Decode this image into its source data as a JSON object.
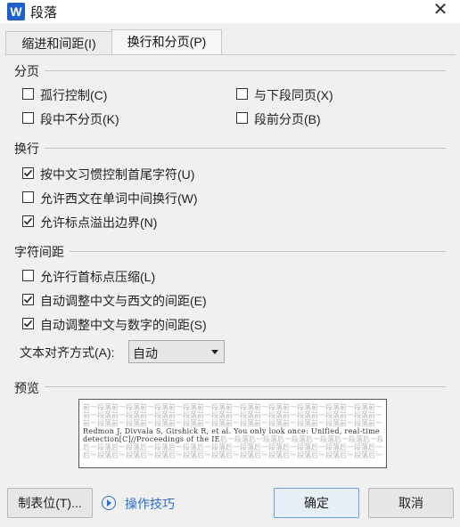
{
  "window": {
    "title": "段落",
    "app_icon_letter": "W",
    "close_glyph": "✕"
  },
  "tabs": [
    {
      "label": "缩进和间距(I)",
      "active": false
    },
    {
      "label": "换行和分页(P)",
      "active": true
    }
  ],
  "pagination": {
    "title": "分页",
    "options": [
      {
        "label": "孤行控制(C)",
        "checked": false
      },
      {
        "label": "与下段同页(X)",
        "checked": false
      },
      {
        "label": "段中不分页(K)",
        "checked": false
      },
      {
        "label": "段前分页(B)",
        "checked": false
      }
    ]
  },
  "line_break": {
    "title": "换行",
    "options": [
      {
        "label": "按中文习惯控制首尾字符(U)",
        "checked": true
      },
      {
        "label": "允许西文在单词中间换行(W)",
        "checked": false
      },
      {
        "label": "允许标点溢出边界(N)",
        "checked": true
      }
    ]
  },
  "char_spacing": {
    "title": "字符间距",
    "options": [
      {
        "label": "允许行首标点压缩(L)",
        "checked": false
      },
      {
        "label": "自动调整中文与西文的间距(E)",
        "checked": true
      },
      {
        "label": "自动调整中文与数字的间距(S)",
        "checked": true
      }
    ],
    "align_label": "文本对齐方式(A):",
    "align_value": "自动"
  },
  "preview": {
    "title": "预览",
    "lines": [
      "前一段落前一段落前一段落前一段落前一段落前一段落前一段落前一段落前一段落前一段落前一段落前一段落前一段落",
      "前一段落前一段落前一段落前一段落前一段落前一段落前一段落前一段落前一段落前一段落前一段落前一段落前一段落",
      "前一段落前一段落前一段落前一段落前一段落前一段落前一段落前一段落前一段落前一段落前一段落前一段落前一段落",
      "Redmon J, Divvala S, Girshick R, et al. You only look once: Unified, real-time object",
      "detection[C]//Proceedings of the IE",
      "后一段落后一段落后一段落后一段落后一段落后一段落后一段落后一段落后一段落后一段落后一段落后一段落后一段落",
      "后一段落后一段落后一段落后一段落后一段落后一段落后一段落后一段落后一段落后一段落后一段落后一段落后一段落"
    ],
    "line5_tail": "后一段落后一段落后一段落后一段落后一段落后一段落后一段落后一段落"
  },
  "buttons": {
    "tabs_label": "制表位(T)...",
    "tips_label": "操作技巧",
    "ok_label": "确定",
    "cancel_label": "取消"
  },
  "colors": {
    "accent": "#2b6dd6",
    "app_icon": "#1e5fc8"
  }
}
